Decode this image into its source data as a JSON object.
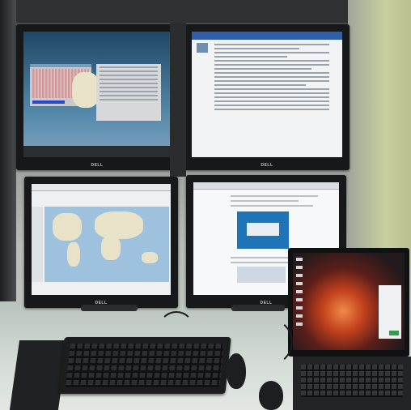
{
  "scene": {
    "description_label": "",
    "monitors": {
      "top_left": {
        "brand": "DELL"
      },
      "top_right": {
        "brand": "DELL"
      },
      "bottom_left": {
        "brand": "DELL"
      },
      "bottom_right": {
        "brand": "DELL"
      }
    }
  }
}
